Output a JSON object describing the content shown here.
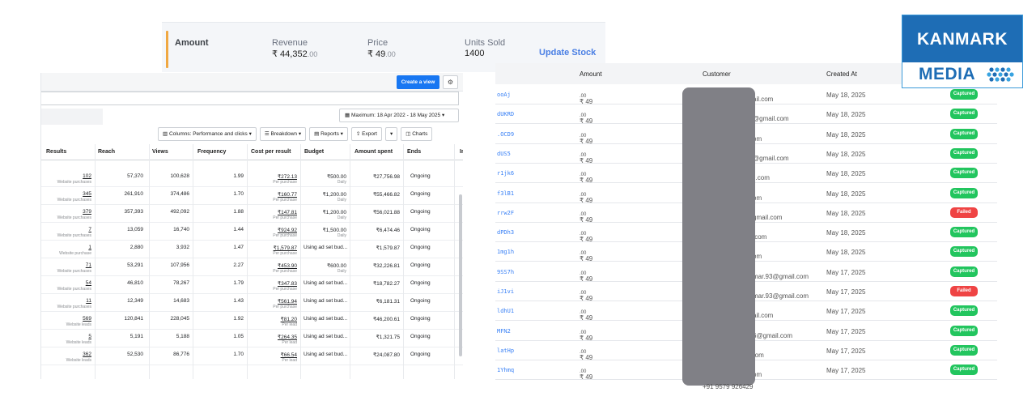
{
  "stats": {
    "amount_label": "Amount",
    "revenue_label": "Revenue",
    "revenue_value": "₹ 44,352",
    "revenue_decimals": ".00",
    "price_label": "Price",
    "price_value": "₹ 49",
    "price_decimals": ".00",
    "units_label": "Units Sold",
    "units_value": "1400",
    "update_label": "Update Stock",
    "accent_color": "#f0a842"
  },
  "ads": {
    "create_label": "Create a view",
    "date_range": "Maximum: 18 Apr 2022 - 18 May 2025",
    "toolbar": {
      "columns": "Columns: Performance and clicks",
      "breakdown": "Breakdown",
      "reports": "Reports",
      "export": "Export",
      "charts": "Charts"
    },
    "headers": [
      "Results",
      "Reach",
      "Views",
      "Frequency",
      "Cost per result",
      "Budget",
      "Amount spent",
      "Ends",
      "Impre"
    ],
    "rows": [
      {
        "results": "102",
        "rtype": "Website purchases",
        "reach": "57,370",
        "views": "100,628",
        "freq": "1.99",
        "cpr": "₹272.13",
        "cpr_sub": "Per purchase",
        "budget": "₹500.00",
        "budget_sub": "Daily",
        "spent": "₹27,756.98",
        "ends": "Ongoing"
      },
      {
        "results": "345",
        "rtype": "Website purchases",
        "reach": "261,910",
        "views": "374,486",
        "freq": "1.70",
        "cpr": "₹160.77",
        "cpr_sub": "Per purchase",
        "budget": "₹1,200.00",
        "budget_sub": "Daily",
        "spent": "₹55,466.82",
        "ends": "Ongoing"
      },
      {
        "results": "379",
        "rtype": "Website purchases",
        "reach": "357,393",
        "views": "492,092",
        "freq": "1.88",
        "cpr": "₹147.81",
        "cpr_sub": "Per purchase",
        "budget": "₹1,200.00",
        "budget_sub": "Daily",
        "spent": "₹56,021.88",
        "ends": "Ongoing"
      },
      {
        "results": "7",
        "rtype": "Website purchases",
        "reach": "13,059",
        "views": "16,740",
        "freq": "1.44",
        "cpr": "₹924.92",
        "cpr_sub": "Per purchase",
        "budget": "₹1,500.00",
        "budget_sub": "Daily",
        "spent": "₹6,474.46",
        "ends": "Ongoing"
      },
      {
        "results": "1",
        "rtype": "Website purchase",
        "reach": "2,880",
        "views": "3,932",
        "freq": "1.47",
        "cpr": "₹1,579.87",
        "cpr_sub": "Per purchase",
        "budget": "Using ad set bud...",
        "budget_sub": "",
        "spent": "₹1,579.87",
        "ends": "Ongoing"
      },
      {
        "results": "71",
        "rtype": "Website purchases",
        "reach": "53,291",
        "views": "107,956",
        "freq": "2.27",
        "cpr": "₹453.90",
        "cpr_sub": "Per purchase",
        "budget": "₹600.00",
        "budget_sub": "Daily",
        "spent": "₹32,226.81",
        "ends": "Ongoing"
      },
      {
        "results": "54",
        "rtype": "Website purchases",
        "reach": "46,810",
        "views": "78,267",
        "freq": "1.79",
        "cpr": "₹347.83",
        "cpr_sub": "Per purchase",
        "budget": "Using ad set bud...",
        "budget_sub": "",
        "spent": "₹18,782.27",
        "ends": "Ongoing"
      },
      {
        "results": "11",
        "rtype": "Website purchases",
        "reach": "12,349",
        "views": "14,683",
        "freq": "1.43",
        "cpr": "₹561.94",
        "cpr_sub": "Per purchase",
        "budget": "Using ad set bud...",
        "budget_sub": "",
        "spent": "₹6,181.31",
        "ends": "Ongoing"
      },
      {
        "results": "569",
        "rtype": "Website leads",
        "reach": "120,841",
        "views": "228,045",
        "freq": "1.92",
        "cpr": "₹81.20",
        "cpr_sub": "Per lead",
        "budget": "Using ad set bud...",
        "budget_sub": "",
        "spent": "₹46,200.61",
        "ends": "Ongoing"
      },
      {
        "results": "5",
        "rtype": "Website leads",
        "reach": "5,191",
        "views": "5,188",
        "freq": "1.05",
        "cpr": "₹264.35",
        "cpr_sub": "Per lead",
        "budget": "Using ad set bud...",
        "budget_sub": "",
        "spent": "₹1,321.75",
        "ends": "Ongoing"
      },
      {
        "results": "362",
        "rtype": "Website leads",
        "reach": "52,530",
        "views": "86,776",
        "freq": "1.70",
        "cpr": "₹66.54",
        "cpr_sub": "Per lead",
        "budget": "Using ad set bud...",
        "budget_sub": "",
        "spent": "₹24,087.80",
        "ends": "Ongoing"
      }
    ]
  },
  "orders": {
    "headers": {
      "amount": "Amount",
      "customer": "Customer",
      "created": "Created At"
    },
    "rows": [
      {
        "id": "ooAj",
        "amount": "₹ 49",
        "dec": ".00",
        "cust": "ail.com",
        "date": "May 18, 2025",
        "status": "Captured"
      },
      {
        "id": "dUKRD",
        "amount": "₹ 49",
        "dec": ".00",
        "cust": "@gmail.com",
        "date": "May 18, 2025",
        "status": "Captured"
      },
      {
        "id": ".OCD9",
        "amount": "₹ 49",
        "dec": ".00",
        "cust": "om",
        "date": "May 18, 2025",
        "status": "Captured"
      },
      {
        "id": "dUS5",
        "amount": "₹ 49",
        "dec": ".00",
        "cust": "@gmail.com",
        "date": "May 18, 2025",
        "status": "Captured"
      },
      {
        "id": "r1jk6",
        "amount": "₹ 49",
        "dec": ".00",
        "cust": "il.com",
        "date": "May 18, 2025",
        "status": "Captured"
      },
      {
        "id": "f3lB1",
        "amount": "₹ 49",
        "dec": ".00",
        "cust": "om",
        "date": "May 18, 2025",
        "status": "Captured"
      },
      {
        "id": "rrw2F",
        "amount": "₹ 49",
        "dec": ".00",
        "cust": "gmail.com",
        "date": "May 18, 2025",
        "status": "Failed"
      },
      {
        "id": "dPDh3",
        "amount": "₹ 49",
        "dec": ".00",
        "cust": ".com",
        "date": "May 18, 2025",
        "status": "Captured"
      },
      {
        "id": "1mg1h",
        "amount": "₹ 49",
        "dec": ".00",
        "cust": "om",
        "date": "May 18, 2025",
        "status": "Captured"
      },
      {
        "id": "9SS7h",
        "amount": "₹ 49",
        "dec": ".00",
        "cust": "mar.93@gmail.com",
        "date": "May 17, 2025",
        "status": "Captured"
      },
      {
        "id": "iJ1vi",
        "amount": "₹ 49",
        "dec": ".00",
        "cust": "mar.93@gmail.com",
        "date": "May 17, 2025",
        "status": "Failed"
      },
      {
        "id": "ldhU1",
        "amount": "₹ 49",
        "dec": ".00",
        "cust": "ail.com",
        "date": "May 17, 2025",
        "status": "Captured"
      },
      {
        "id": "MFN2",
        "amount": "₹ 49",
        "dec": ".00",
        "cust": "6@gmail.com",
        "date": "May 17, 2025",
        "status": "Captured"
      },
      {
        "id": "latHp",
        "amount": "₹ 49",
        "dec": ".00",
        "cust": "rom",
        "date": "May 17, 2025",
        "status": "Captured"
      },
      {
        "id": "1Yhmq",
        "amount": "₹ 49",
        "dec": ".00",
        "cust": "om",
        "date": "May 17, 2025",
        "status": "Captured"
      }
    ],
    "phone_partial": "+91 9579 926429",
    "status_colors": {
      "Captured": "#22c55e",
      "Failed": "#ef4444"
    }
  },
  "logo": {
    "line1": "KANMARK",
    "line2": "MEDIA",
    "brand_color": "#1e6db5"
  }
}
